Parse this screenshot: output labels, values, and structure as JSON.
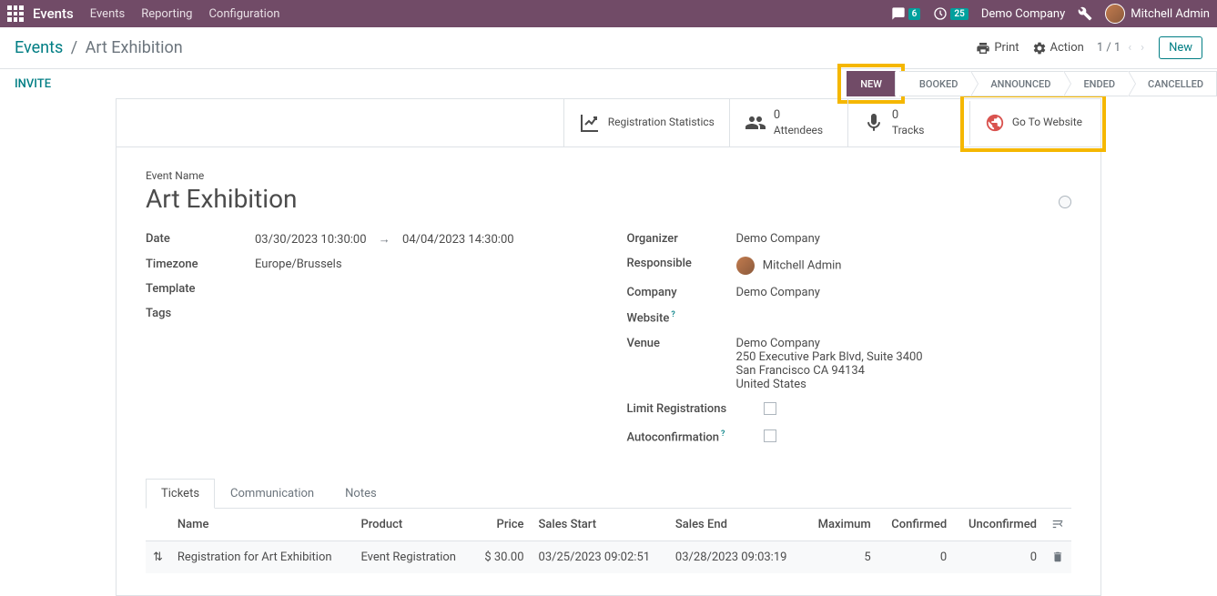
{
  "navbar": {
    "brand": "Events",
    "menu": [
      "Events",
      "Reporting",
      "Configuration"
    ],
    "chat_badge": "6",
    "clock_badge": "25",
    "company": "Demo Company",
    "user": "Mitchell Admin"
  },
  "breadcrumb": {
    "root": "Events",
    "current": "Art Exhibition"
  },
  "controls": {
    "print": "Print",
    "action": "Action",
    "pager": "1 / 1",
    "new_btn": "New"
  },
  "statusbar": {
    "invite": "INVITE",
    "stages": [
      "NEW",
      "BOOKED",
      "ANNOUNCED",
      "ENDED",
      "CANCELLED"
    ],
    "active_index": 0
  },
  "stat_buttons": {
    "registration": "Registration Statistics",
    "attendees_count": "0",
    "attendees_label": "Attendees",
    "tracks_count": "0",
    "tracks_label": "Tracks",
    "website": "Go To Website"
  },
  "form": {
    "name_label": "Event Name",
    "name": "Art Exhibition",
    "labels": {
      "date": "Date",
      "timezone": "Timezone",
      "template": "Template",
      "tags": "Tags",
      "organizer": "Organizer",
      "responsible": "Responsible",
      "company": "Company",
      "website": "Website",
      "venue": "Venue",
      "limit": "Limit Registrations",
      "autoconfirm": "Autoconfirmation"
    },
    "date_begin": "03/30/2023 10:30:00",
    "date_end": "04/04/2023 14:30:00",
    "timezone": "Europe/Brussels",
    "organizer": "Demo Company",
    "responsible": "Mitchell Admin",
    "company": "Demo Company",
    "venue": {
      "name": "Demo Company",
      "street": "250 Executive Park Blvd, Suite 3400",
      "city": "San Francisco CA 94134",
      "country": "United States"
    }
  },
  "tabs": {
    "items": [
      "Tickets",
      "Communication",
      "Notes"
    ],
    "active_index": 0
  },
  "tickets": {
    "headers": {
      "name": "Name",
      "product": "Product",
      "price": "Price",
      "sales_start": "Sales Start",
      "sales_end": "Sales End",
      "maximum": "Maximum",
      "confirmed": "Confirmed",
      "unconfirmed": "Unconfirmed"
    },
    "rows": [
      {
        "name": "Registration for Art Exhibition",
        "product": "Event Registration",
        "price": "$ 30.00",
        "sales_start": "03/25/2023 09:02:51",
        "sales_end": "03/28/2023 09:03:19",
        "maximum": "5",
        "confirmed": "0",
        "unconfirmed": "0"
      }
    ]
  }
}
